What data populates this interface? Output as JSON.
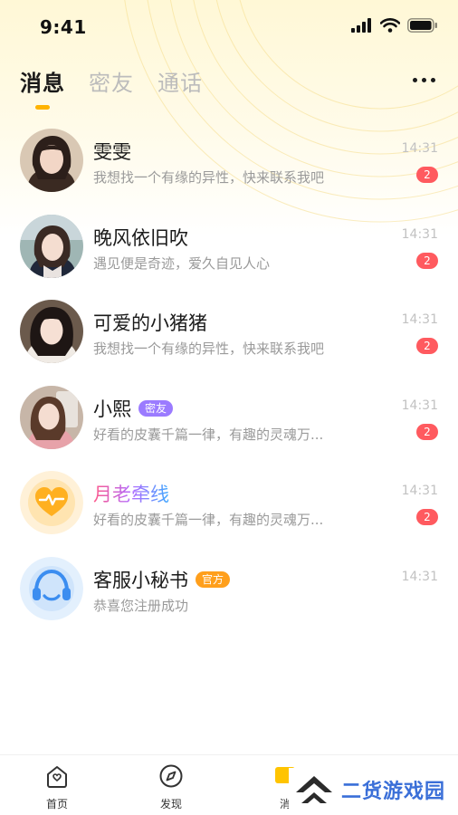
{
  "status_bar": {
    "time": "9:41"
  },
  "header": {
    "tabs": [
      {
        "label": "消息",
        "active": true
      },
      {
        "label": "密友",
        "active": false
      },
      {
        "label": "通话",
        "active": false
      }
    ]
  },
  "chats": [
    {
      "name": "雯雯",
      "preview": "我想找一个有缘的异性，快来联系我吧",
      "time": "14:31",
      "unread": "2",
      "tag": ""
    },
    {
      "name": "晚风依旧吹",
      "preview": "遇见便是奇迹，爱久自见人心",
      "time": "14:31",
      "unread": "2",
      "tag": ""
    },
    {
      "name": "可爱的小猪猪",
      "preview": "我想找一个有缘的异性，快来联系我吧",
      "time": "14:31",
      "unread": "2",
      "tag": ""
    },
    {
      "name": "小熙",
      "preview": "好看的皮囊千篇一律，有趣的灵魂万...",
      "time": "14:31",
      "unread": "2",
      "tag": "密友"
    },
    {
      "name": "月老牵线",
      "preview": "好看的皮囊千篇一律，有趣的灵魂万...",
      "time": "14:31",
      "unread": "2",
      "tag": ""
    },
    {
      "name": "客服小秘书",
      "preview": "恭喜您注册成功",
      "time": "14:31",
      "unread": "",
      "tag": "官方"
    }
  ],
  "bottom_nav": {
    "items": [
      {
        "label": "首页",
        "icon": "home-icon"
      },
      {
        "label": "发现",
        "icon": "compass-icon"
      },
      {
        "label": "消",
        "icon": "message-icon"
      }
    ],
    "watermark": "二货游戏园"
  },
  "colors": {
    "accent": "#ffb300",
    "unread_badge": "#ff5a5f",
    "tag_friend": "#9b7bff",
    "tag_official": "#ff9f1c"
  }
}
